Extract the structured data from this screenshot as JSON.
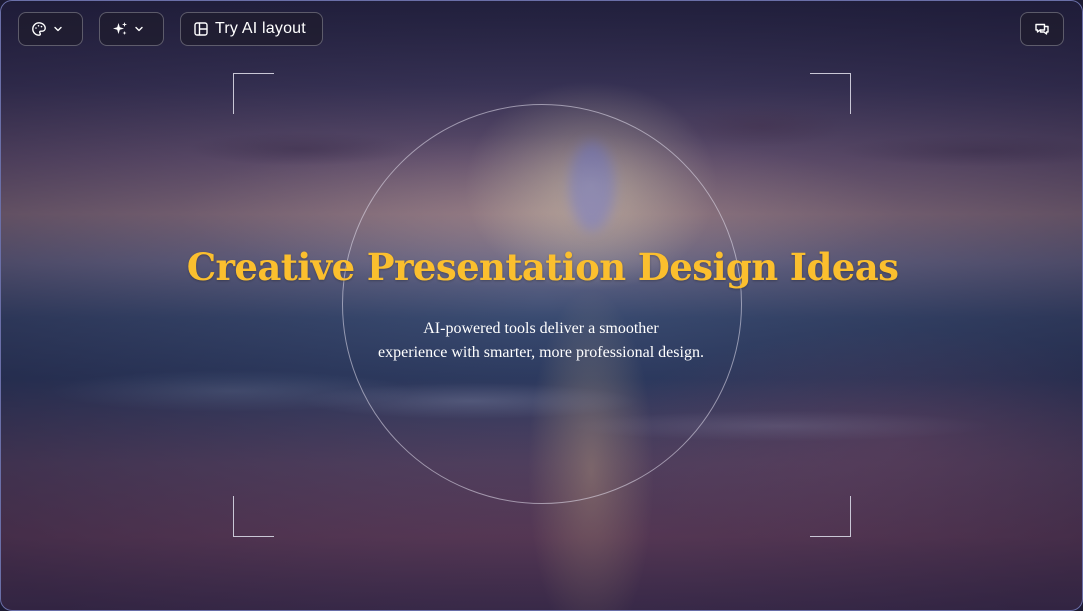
{
  "toolbar": {
    "theme_icon": "palette-icon",
    "ai_icon": "sparkles-icon",
    "layout_icon": "layout-icon",
    "layout_label": "Try AI layout",
    "chat_icon": "chat-icon"
  },
  "slide": {
    "title": "Creative Presentation Design Ideas",
    "subtitle_line1": "AI-powered tools deliver a smoother",
    "subtitle_line2": "experience with smarter, more professional design."
  },
  "colors": {
    "title": "#fbbf2e",
    "subtitle": "#ffffff",
    "frame_border": "#6a6fa8"
  }
}
